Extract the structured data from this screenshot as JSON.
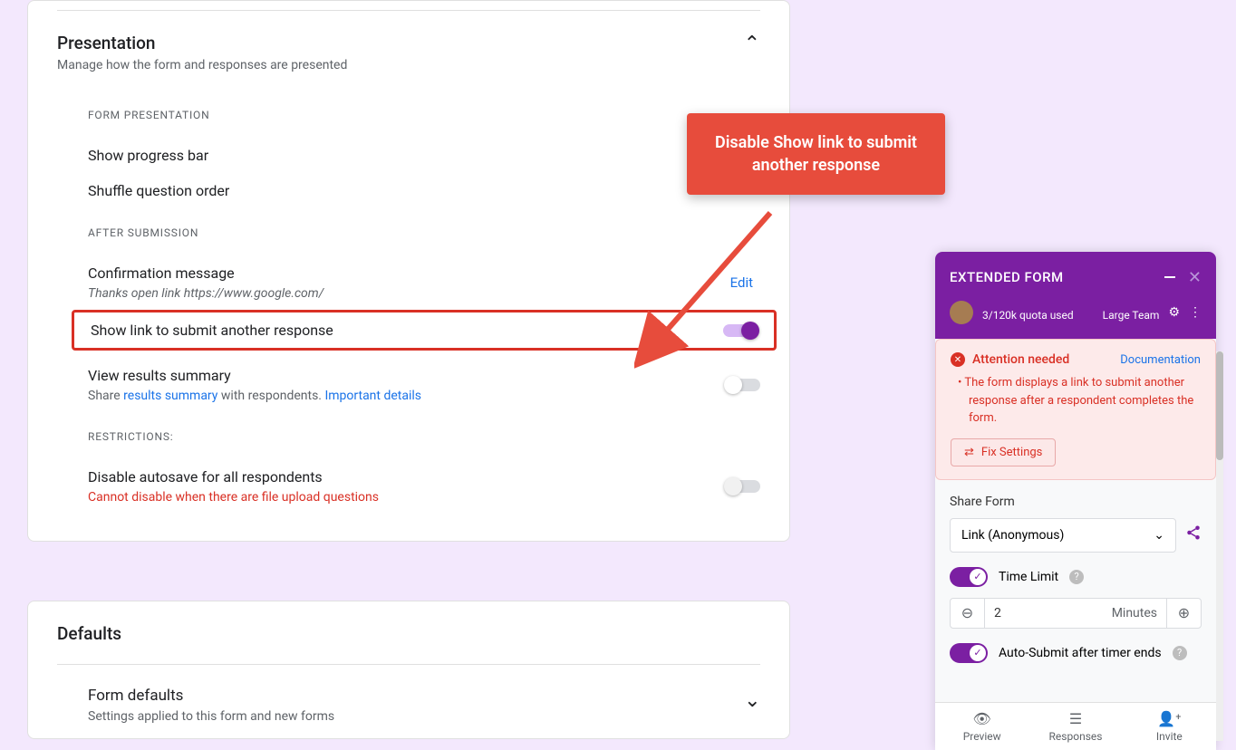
{
  "presentation": {
    "title": "Presentation",
    "subtitle": "Manage how the form and responses are presented",
    "form_presentation_label": "FORM PRESENTATION",
    "show_progress": "Show progress bar",
    "shuffle": "Shuffle question order",
    "after_submission_label": "AFTER SUBMISSION",
    "confirmation_title": "Confirmation message",
    "confirmation_msg": "Thanks open link https://www.google.com/",
    "edit_label": "Edit",
    "show_link": "Show link to submit another response",
    "view_results": "View results summary",
    "view_results_prefix": "Share ",
    "results_summary": "results summary",
    "view_results_mid": " with respondents. ",
    "important_details": "Important details",
    "restrictions_label": "RESTRICTIONS:",
    "disable_autosave": "Disable autosave for all respondents",
    "autosave_warn": "Cannot disable when there are file upload questions"
  },
  "defaults": {
    "title": "Defaults",
    "form_defaults": "Form defaults",
    "form_defaults_sub": "Settings applied to this form and new forms"
  },
  "tooltip": {
    "text": "Disable Show link to submit another response"
  },
  "sidebar": {
    "title": "EXTENDED FORM",
    "quota": "3/120k quota used",
    "plan": "Large Team",
    "alert_title": "Attention needed",
    "documentation": "Documentation",
    "alert_msg": "The form displays a link to submit another response after a respondent completes the form.",
    "fix_settings": "Fix Settings",
    "share_label": "Share Form",
    "share_value": "Link (Anonymous)",
    "time_limit": "Time Limit",
    "time_value": "2",
    "time_unit": "Minutes",
    "auto_submit": "Auto-Submit after timer ends",
    "nav": {
      "preview": "Preview",
      "responses": "Responses",
      "invite": "Invite"
    }
  }
}
